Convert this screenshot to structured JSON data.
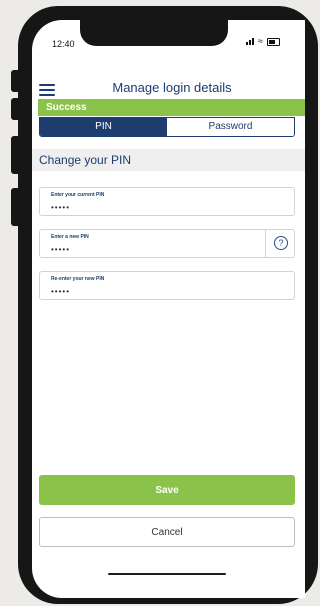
{
  "status_bar": {
    "time": "12:40"
  },
  "header": {
    "title": "Manage login details",
    "menu_icon": "hamburger-menu-icon"
  },
  "banner": {
    "text": "Success",
    "color": "#8bc34a"
  },
  "tabs": [
    {
      "label": "PIN",
      "active": true
    },
    {
      "label": "Password",
      "active": false
    }
  ],
  "section": {
    "title": "Change your PIN"
  },
  "fields": {
    "current_pin": {
      "label": "Enter your current PIN",
      "value": "•••••"
    },
    "new_pin": {
      "label": "Enter a new PIN",
      "value": "•••••",
      "help_icon": "question-circle-icon"
    },
    "confirm_pin": {
      "label": "Re-enter your new PIN",
      "value": "•••••"
    }
  },
  "actions": {
    "save_label": "Save",
    "cancel_label": "Cancel"
  },
  "colors": {
    "primary": "#1d3d6f",
    "accent": "#8bc34a"
  }
}
